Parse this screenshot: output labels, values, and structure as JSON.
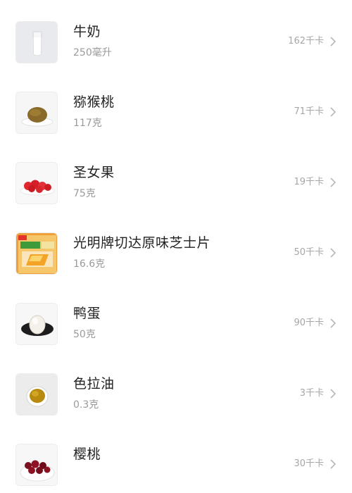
{
  "food_list": {
    "items": [
      {
        "name": "牛奶",
        "amount": "250毫升",
        "calories": "162千卡",
        "image_icon": "milk-glass-icon"
      },
      {
        "name": "猕猴桃",
        "amount": "117克",
        "calories": "71千卡",
        "image_icon": "kiwi-icon"
      },
      {
        "name": "圣女果",
        "amount": "75克",
        "calories": "19千卡",
        "image_icon": "cherry-tomato-icon"
      },
      {
        "name": "光明牌切达原味芝士片",
        "amount": "16.6克",
        "calories": "50千卡",
        "image_icon": "cheese-package-icon"
      },
      {
        "name": "鸭蛋",
        "amount": "50克",
        "calories": "90千卡",
        "image_icon": "duck-egg-icon"
      },
      {
        "name": "色拉油",
        "amount": "0.3克",
        "calories": "3千卡",
        "image_icon": "oil-bowl-icon"
      },
      {
        "name": "樱桃",
        "amount": "",
        "calories": "30千卡",
        "image_icon": "cherry-icon"
      }
    ],
    "chevron_icon": "chevron-right-icon",
    "colors": {
      "name_text": "#222222",
      "secondary_text": "#9a9a9a",
      "background": "#ffffff"
    }
  }
}
